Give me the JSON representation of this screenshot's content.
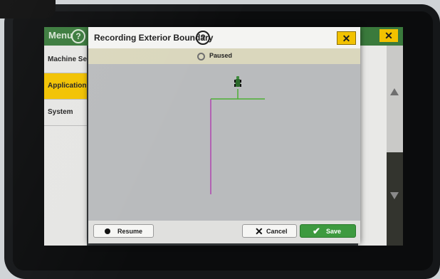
{
  "background_menu": {
    "title": "Menu",
    "help_icon": "help-circle-icon",
    "close_icon": "close-icon",
    "sidebar_items": [
      {
        "label": "Machine Settings"
      },
      {
        "label": "Applications"
      },
      {
        "label": "System"
      }
    ],
    "active_item": "Applications",
    "colors": {
      "header_green": "#3a7a3c",
      "active_yellow": "#f2c200"
    }
  },
  "dialog": {
    "title": "Recording Exterior Boundary",
    "help_icon": "help-circle-icon",
    "close_icon": "close-icon",
    "close_glyph": "✕",
    "status": {
      "text": "Paused",
      "icon": "status-circle-icon"
    },
    "map": {
      "background_color": "#b9bbbd",
      "recorded_line_color": "#b044b0",
      "implement_color": "#4caf34",
      "vehicle_icon": "tractor-icon"
    },
    "buttons": {
      "resume": {
        "label": "Resume",
        "icon": "record-dot-icon"
      },
      "cancel": {
        "label": "Cancel",
        "icon": "x-icon",
        "glyph": "✕"
      },
      "save": {
        "label": "Save",
        "icon": "checkmark-icon",
        "glyph": "✔",
        "color": "#3d9a3f"
      }
    }
  }
}
